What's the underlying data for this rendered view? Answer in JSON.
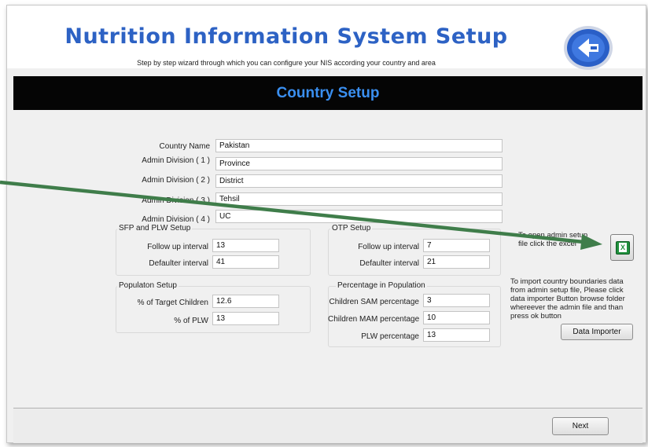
{
  "header": {
    "title": "Nutrition Information System Setup",
    "subtitle": "Step by step wizard through which you can configure your NIS according your country and area",
    "logo": "nis-logo-icon"
  },
  "banner": {
    "title": "Country Setup"
  },
  "country": {
    "rows": [
      {
        "label": "Country Name",
        "value": "Pakistan"
      },
      {
        "label": "Admin Division ( 1 )",
        "value": "Province"
      },
      {
        "label": "Admin Division ( 2 )",
        "value": "District"
      },
      {
        "label": "Admin Division ( 3 )",
        "value": "Tehsil"
      },
      {
        "label": "Admin Division ( 4 )",
        "value": "UC"
      }
    ]
  },
  "sfp": {
    "title": "SFP and PLW Setup",
    "follow_label": "Follow up interval",
    "follow_value": "13",
    "defaulter_label": "Defaulter interval",
    "defaulter_value": "41"
  },
  "otp": {
    "title": "OTP Setup",
    "follow_label": "Follow up interval",
    "follow_value": "7",
    "defaulter_label": "Defaulter interval",
    "defaulter_value": "21"
  },
  "population": {
    "title": "Populaton Setup",
    "target_label": "% of Target Children",
    "target_value": "12.6",
    "plw_label": "% of PLW",
    "plw_value": "13"
  },
  "percentage": {
    "title": "Percentage in Population",
    "sam_label": "Children SAM percentage",
    "sam_value": "3",
    "mam_label": "Children MAM percentage",
    "mam_value": "10",
    "plw_label": "PLW percentage",
    "plw_value": "13"
  },
  "excel": {
    "note_line1": "To open admin setup",
    "note_line2": "file click the excel",
    "icon": "excel-icon"
  },
  "importer": {
    "note_line1": "To import country boundaries data",
    "note_line2": "from admin setup file,  Please click",
    "note_line3": "data importer Button browse folder",
    "note_line4": "whereever the admin file and than",
    "note_line5": "press ok button",
    "button_label": "Data Importer"
  },
  "footer": {
    "next_label": "Next"
  },
  "colors": {
    "title": "#2d62c4",
    "banner_bg": "#050505",
    "banner_text": "#3a8ff0",
    "arrow": "#3f7d4a"
  }
}
